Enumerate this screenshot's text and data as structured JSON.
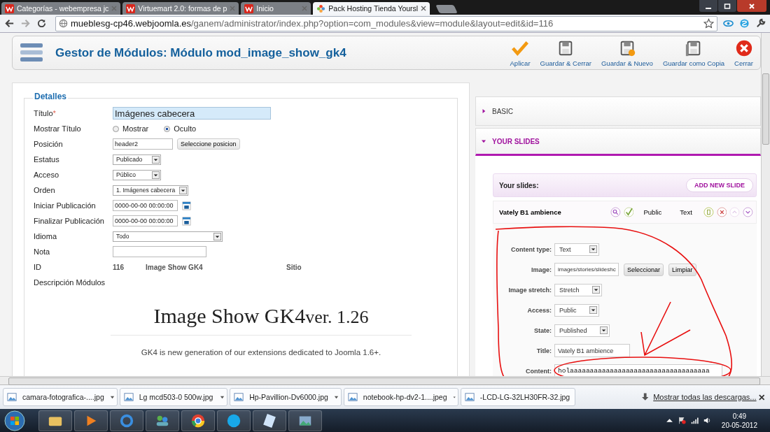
{
  "browser": {
    "tabs": [
      {
        "title": "Categorías - webempresa jc",
        "selected": false
      },
      {
        "title": "Virtuemart 2.0: formas de p",
        "selected": false
      },
      {
        "title": "Inicio",
        "selected": false
      },
      {
        "title": "Pack Hosting Tienda Yoursl",
        "selected": true
      }
    ],
    "address": {
      "host": "mueblesg-cp46.webjoomla.es",
      "path": "/ganem/administrator/index.php?option=com_modules&view=module&layout=edit&id=116"
    }
  },
  "toolbar": {
    "title": "Gestor de Módulos: Módulo mod_image_show_gk4",
    "buttons": [
      {
        "label": "Aplicar",
        "kind": "apply"
      },
      {
        "label": "Guardar & Cerrar",
        "kind": "save"
      },
      {
        "label": "Guardar & Nuevo",
        "kind": "save-new"
      },
      {
        "label": "Guardar como Copia",
        "kind": "save-copy"
      },
      {
        "label": "Cerrar",
        "kind": "close"
      }
    ]
  },
  "details": {
    "legend": "Detalles",
    "fields": [
      {
        "label": "Título",
        "required": "*",
        "kind": "input",
        "value": "Imágenes cabecera",
        "focused": true
      },
      {
        "label": "Mostrar Título",
        "kind": "radio",
        "options": [
          {
            "label": "Mostrar",
            "selected": false
          },
          {
            "label": "Oculto",
            "selected": true
          }
        ]
      },
      {
        "label": "Posición",
        "kind": "input-button",
        "value": "header2",
        "button": "Seleccione posicion"
      },
      {
        "label": "Estatus",
        "kind": "select",
        "value": "Publicado"
      },
      {
        "label": "Acceso",
        "kind": "select",
        "value": "Público"
      },
      {
        "label": "Orden",
        "kind": "select",
        "value": "1. Imágenes cabecera"
      },
      {
        "label": "Iniciar Publicación",
        "kind": "date",
        "value": "0000-00-00 00:00:00"
      },
      {
        "label": "Finalizar Publicación",
        "kind": "date",
        "value": "0000-00-00 00:00:00"
      },
      {
        "label": "Idioma",
        "kind": "select-wide",
        "value": "Todo"
      },
      {
        "label": "Nota",
        "kind": "note"
      },
      {
        "label": "ID",
        "kind": "info",
        "values": [
          "116",
          "Image Show GK4",
          "Sitio"
        ]
      },
      {
        "label": "Descripción Módulos",
        "kind": "label"
      }
    ],
    "description": {
      "heading": "Image Show GK4",
      "version": "ver. 1.26",
      "text": "GK4 is new generation of our extensions dedicated to Joomla 1.6+."
    }
  },
  "panels": [
    {
      "title": "BASIC",
      "expanded": false
    },
    {
      "title": "YOUR SLIDES",
      "expanded": true
    }
  ],
  "slides": {
    "heading": "Your slides:",
    "add_button": "ADD NEW SLIDE",
    "slide": {
      "title": "Vately B1 ambience",
      "access": "Public",
      "type": "Text"
    },
    "form": [
      {
        "label": "Content type:",
        "kind": "select",
        "value": "Text"
      },
      {
        "label": "Image:",
        "kind": "image",
        "value": "images/stories/slideshc",
        "buttons": [
          "Seleccionar",
          "Limpiar"
        ]
      },
      {
        "label": "Image stretch:",
        "kind": "select",
        "value": "Stretch"
      },
      {
        "label": "Access:",
        "kind": "select",
        "value": "Public"
      },
      {
        "label": "State:",
        "kind": "select",
        "value": "Published"
      },
      {
        "label": "Title:",
        "kind": "input",
        "value": "Vately B1 ambience"
      },
      {
        "label": "Content:",
        "kind": "content",
        "value": "holaaaaaaaaaaaaaaaaaaaaaaaaaaaaaaaaaaa"
      }
    ]
  },
  "downloads": {
    "items": [
      "camara-fotografica-....jpg",
      "Lg mcd503-0 500w.jpg",
      "Hp-Pavillion-Dv6000.jpg",
      "notebook-hp-dv2-1....jpeg",
      "-LCD-LG-32LH30FR-32.jpg"
    ],
    "show_all": "Mostrar todas las descargas..."
  },
  "taskbar": {
    "time": "0:49",
    "date": "20-05-2012"
  }
}
